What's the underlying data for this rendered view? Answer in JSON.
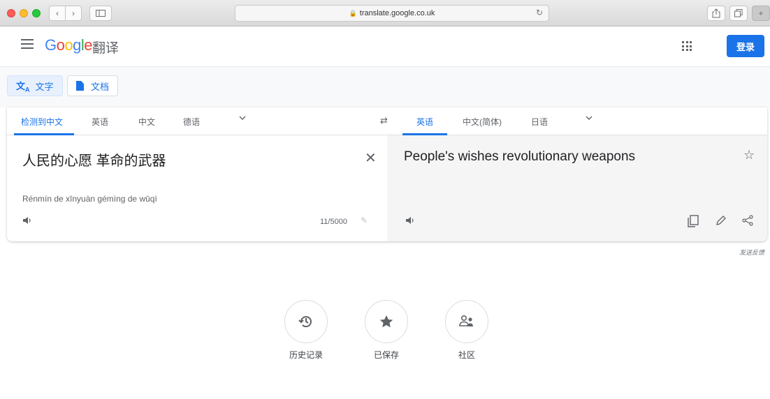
{
  "browser": {
    "url": "translate.google.co.uk",
    "back_icon": "chevron-left",
    "forward_icon": "chevron-right"
  },
  "header": {
    "logo_letters": [
      "G",
      "o",
      "o",
      "g",
      "l",
      "e"
    ],
    "product": "翻译",
    "signin": "登录"
  },
  "modes": {
    "text": "文字",
    "documents": "文档"
  },
  "source_langs": [
    "检测到中文",
    "英语",
    "中文",
    "德语"
  ],
  "target_langs": [
    "英语",
    "中文(简体)",
    "日语"
  ],
  "source": {
    "text": "人民的心愿 革命的武器",
    "romanization": "Rénmín de xīnyuàn gémìng de wǔqì",
    "char_count": "11/5000"
  },
  "target": {
    "text": "People's wishes revolutionary weapons"
  },
  "feedback": "发送反馈",
  "actions": {
    "history": "历史记录",
    "saved": "已保存",
    "community": "社区"
  },
  "colors": {
    "accent": "#1a73e8",
    "google_blue": "#4285f4",
    "google_red": "#ea4335",
    "google_yellow": "#fbbc05",
    "google_green": "#34a853"
  }
}
